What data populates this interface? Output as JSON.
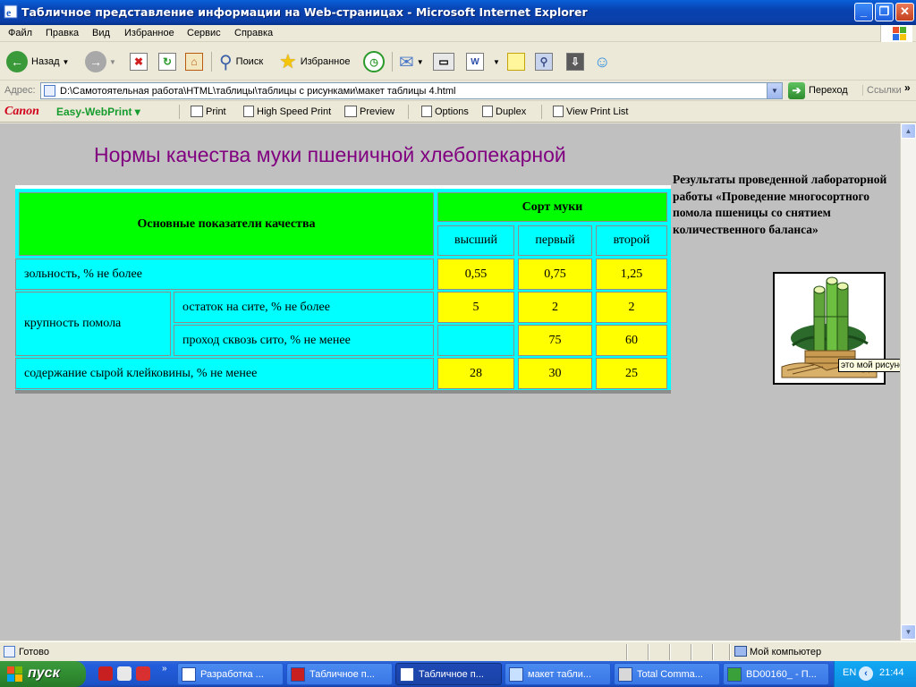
{
  "window": {
    "title": "Табличное представление информации на Web-страницах - Microsoft Internet Explorer",
    "minimize": "_",
    "maximize": "❐",
    "close": "✕"
  },
  "menu": [
    "Файл",
    "Правка",
    "Вид",
    "Избранное",
    "Сервис",
    "Справка"
  ],
  "toolbar": {
    "back": "Назад",
    "search": "Поиск",
    "favorites": "Избранное"
  },
  "address": {
    "label": "Адрес:",
    "url": "D:\\Самотоятельная работа\\HTML\\таблицы\\таблицы с рисунками\\макет таблицы 4.html",
    "go": "Переход",
    "links": "Ссылки"
  },
  "canon": {
    "brand": "Canon",
    "product": "Easy-WebPrint",
    "print": "Print",
    "high_speed": "High Speed Print",
    "preview": "Preview",
    "options": "Options",
    "duplex": "Duplex",
    "view_list": "View Print List"
  },
  "page": {
    "heading": "Нормы качества муки пшеничной хлебопекарной",
    "side_text": "Результаты проведенной лабораторной работы «Проведение многосортного помола пшеницы со снятием количественного баланса»",
    "tooltip": "это мой рисунок"
  },
  "table": {
    "header_main": "Основные показатели качества",
    "header_sort": "Сорт муки",
    "grades": [
      "высший",
      "первый",
      "второй"
    ],
    "rows": {
      "ash": {
        "label": "зольность, % не более",
        "values": [
          "0,55",
          "0,75",
          "1,25"
        ]
      },
      "grind_group": "крупность помола",
      "residue": {
        "label": "остаток на сите, % не более",
        "values": [
          "5",
          "2",
          "2"
        ]
      },
      "passage": {
        "label": "проход сквозь сито, % не менее",
        "values": [
          "",
          "75",
          "60"
        ]
      },
      "gluten": {
        "label": "содержание сырой клейковины, % не менее",
        "values": [
          "28",
          "30",
          "25"
        ]
      }
    }
  },
  "status": {
    "text": "Готово",
    "zone": "Мой компьютер"
  },
  "taskbar": {
    "start": "пуск",
    "buttons": [
      "Разработка ...",
      "Табличное п...",
      "Табличное п...",
      "макет табли...",
      "Total Comma...",
      "BD00160_ - П..."
    ],
    "lang": "EN",
    "time": "21:44"
  },
  "colors": {
    "heading": "#800080",
    "table_cyan": "#00ffff",
    "table_green": "#00ff00",
    "table_yellow": "#ffff00",
    "page_bg": "#c0c0c0"
  }
}
